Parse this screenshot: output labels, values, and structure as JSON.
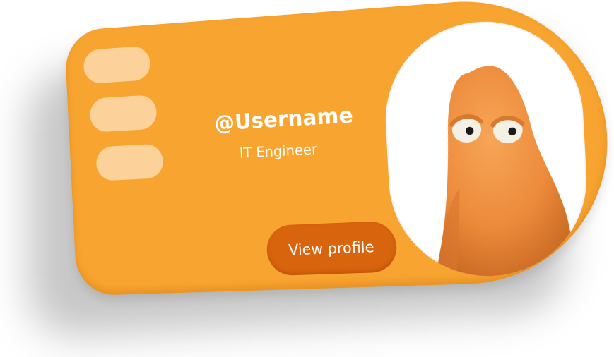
{
  "profile": {
    "username": "@Username",
    "role": "IT Engineer",
    "view_profile_label": "View profile"
  },
  "colors": {
    "card": "#f8a430",
    "pill": "#fdd29a",
    "button": "#d9640e",
    "text": "#ffffff"
  },
  "icons": {
    "avatar": "orange-blob-character"
  }
}
